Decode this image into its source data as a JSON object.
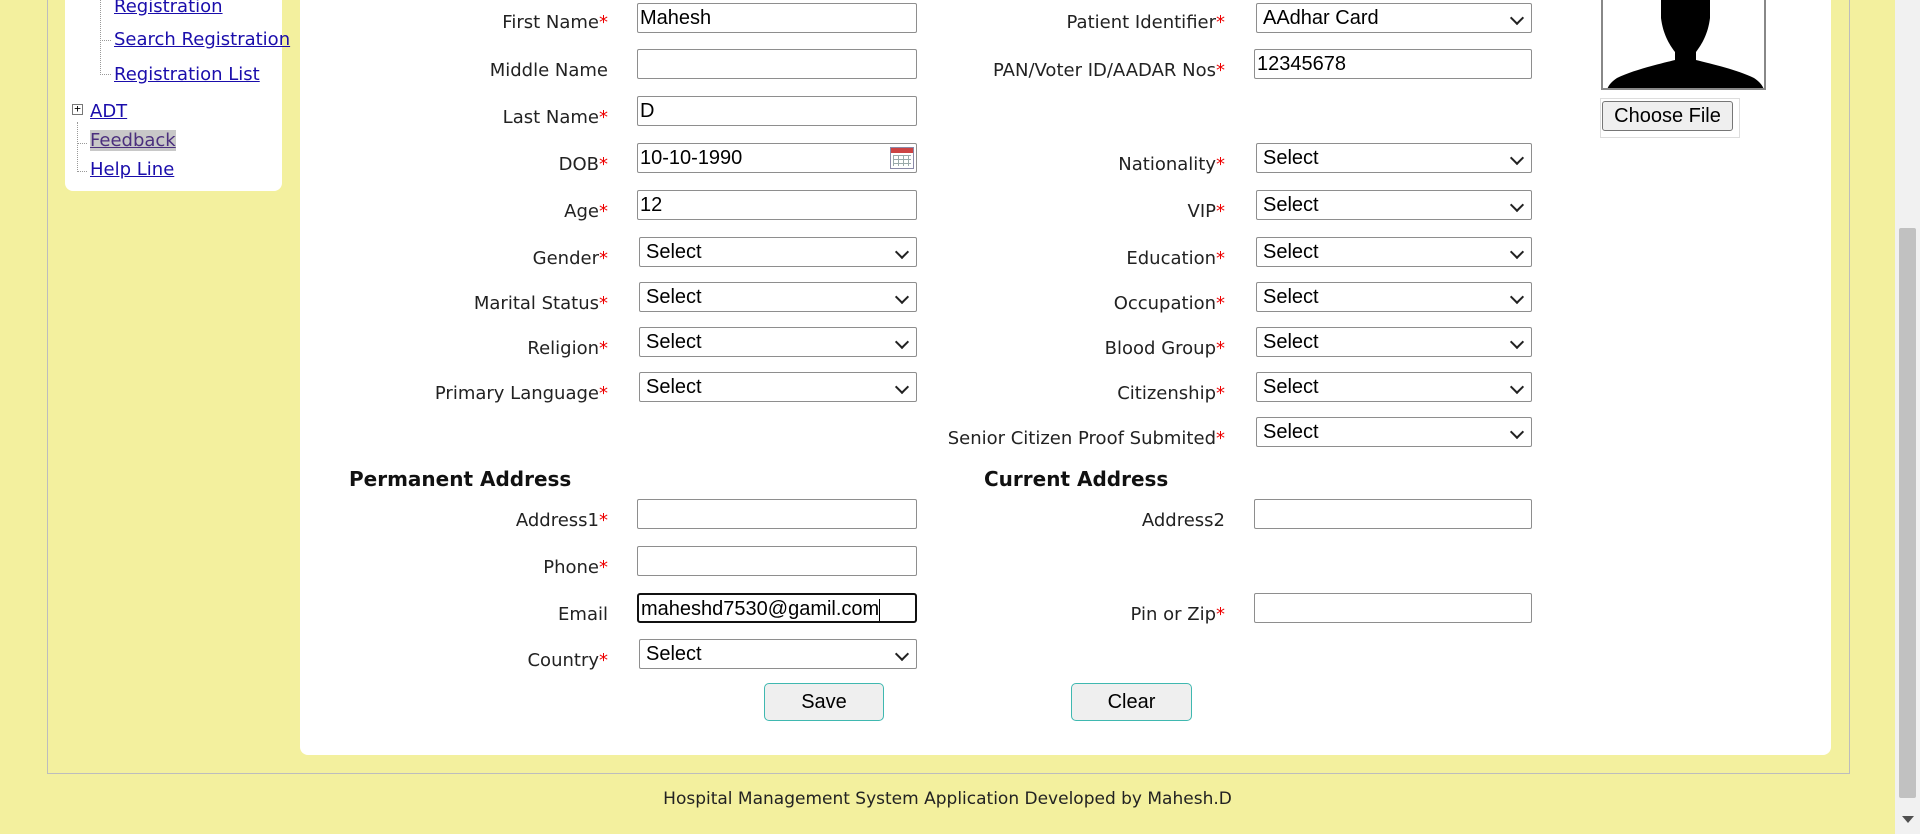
{
  "sidebar": {
    "items": [
      {
        "label": "Registration"
      },
      {
        "label": "Search Registration"
      },
      {
        "label": "Registration List"
      },
      {
        "label": "ADT"
      },
      {
        "label": "Feedback"
      },
      {
        "label": "Help Line"
      }
    ]
  },
  "form": {
    "required_mark": "*",
    "left": {
      "first_name": {
        "label": "First Name",
        "value": "Mahesh"
      },
      "middle_name": {
        "label": "Middle Name",
        "value": ""
      },
      "last_name": {
        "label": "Last Name",
        "value": "D"
      },
      "dob": {
        "label": "DOB",
        "value": "10-10-1990"
      },
      "age": {
        "label": "Age",
        "value": "12"
      },
      "gender": {
        "label": "Gender",
        "value": "Select"
      },
      "marital_status": {
        "label": "Marital Status",
        "value": "Select"
      },
      "religion": {
        "label": "Religion",
        "value": "Select"
      },
      "primary_language": {
        "label": "Primary Language",
        "value": "Select"
      }
    },
    "right": {
      "patient_identifier": {
        "label": "Patient Identifier",
        "value": "AAdhar Card"
      },
      "id_numbers": {
        "label": "PAN/Voter ID/AADAR Nos",
        "value": "12345678"
      },
      "nationality": {
        "label": "Nationality",
        "value": "Select"
      },
      "vip": {
        "label": "VIP",
        "value": "Select"
      },
      "education": {
        "label": "Education",
        "value": "Select"
      },
      "occupation": {
        "label": "Occupation",
        "value": "Select"
      },
      "blood_group": {
        "label": "Blood Group",
        "value": "Select"
      },
      "citizenship": {
        "label": "Citizenship",
        "value": "Select"
      },
      "senior_citizen": {
        "label": "Senior Citizen Proof Submited",
        "value": "Select"
      }
    },
    "permanent_address": {
      "title": "Permanent Address",
      "address1": {
        "label": "Address1",
        "value": ""
      },
      "phone": {
        "label": "Phone",
        "value": ""
      },
      "email": {
        "label": "Email",
        "value": "maheshd7530@gamil.com"
      },
      "country": {
        "label": "Country",
        "value": "Select"
      }
    },
    "current_address": {
      "title": "Current Address",
      "address2": {
        "label": "Address2",
        "value": ""
      },
      "pin": {
        "label": "Pin or Zip",
        "value": ""
      }
    },
    "photo": {
      "choose_file_label": "Choose File"
    },
    "buttons": {
      "save": "Save",
      "clear": "Clear"
    }
  },
  "footer": {
    "text": "Hospital Management System Application Developed by Mahesh.D"
  }
}
